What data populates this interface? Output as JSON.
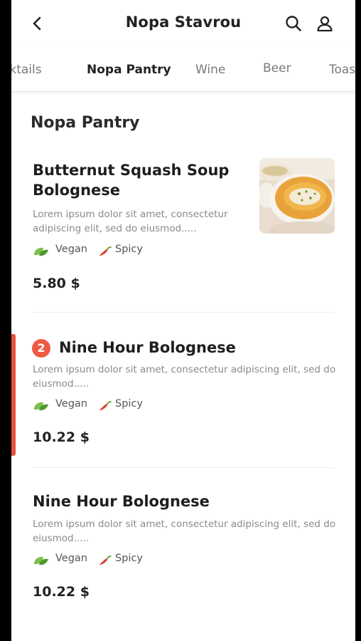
{
  "header": {
    "title": "Nopa Stavrou"
  },
  "tabs": [
    {
      "label": "cktails"
    },
    {
      "label": "Nopa Pantry"
    },
    {
      "label": "Wine"
    },
    {
      "label": "Beer"
    },
    {
      "label": "Toas"
    }
  ],
  "section": {
    "title": "Nopa Pantry"
  },
  "colors": {
    "accent": "#ef5a43",
    "vegan": "#6bb33c",
    "spicy": "#d8412f"
  },
  "items": [
    {
      "name_line1": "Butternut Squash Soup",
      "name_line2": "Bolognese",
      "desc_line1": "Lorem ipsum dolor sit amet, consectetur",
      "desc_line2": "adipiscing elit, sed do eiusmod.....",
      "tags": [
        "Vegan",
        "Spicy"
      ],
      "price": "5.80 $",
      "image": "soup-bowl-photo"
    },
    {
      "badge": "2",
      "name": "Nine Hour Bolognese",
      "desc_line1": "Lorem ipsum dolor sit amet, consectetur adipiscing elit, sed do",
      "desc_line2": "eiusmod.....",
      "tags": [
        "Vegan",
        "Spicy"
      ],
      "price": "10.22 $"
    },
    {
      "name": "Nine Hour Bolognese",
      "desc_line1": "Lorem ipsum dolor sit amet, consectetur adipiscing elit, sed do",
      "desc_line2": "eiusmod.....",
      "tags": [
        "Vegan",
        "Spicy"
      ],
      "price": "10.22 $"
    }
  ]
}
